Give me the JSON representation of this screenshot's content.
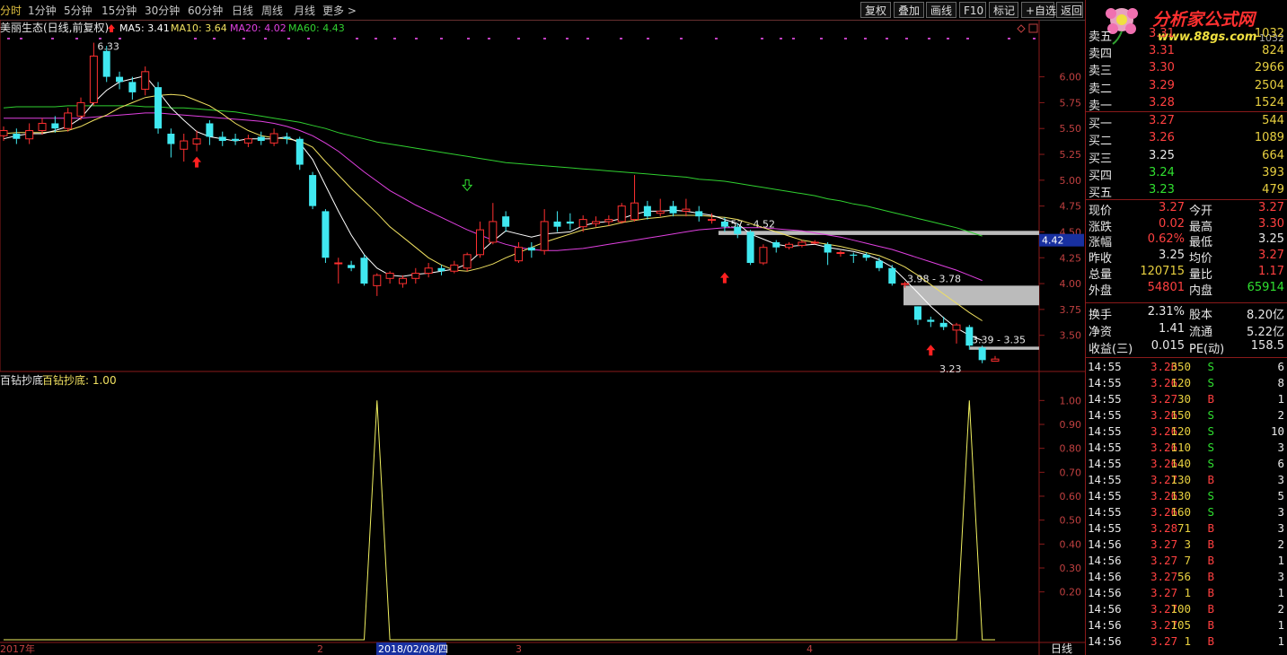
{
  "toolbar": {
    "periods": [
      "分时",
      "1分钟",
      "5分钟",
      "15分钟",
      "30分钟",
      "60分钟",
      "日线",
      "周线",
      "月线",
      "更多 >"
    ],
    "active_index": 0,
    "buttons": [
      "复权",
      "叠加",
      "画线",
      "F10",
      "标记",
      "+自选",
      "返回"
    ]
  },
  "logo": {
    "title": "分析家公式网",
    "url": "www.88gs.com",
    "top_right": "1032"
  },
  "main_chart": {
    "stock_label": "美丽生态(日线,前复权)",
    "ma5": "MA5: 3.41",
    "ma10": "MA10: 3.64",
    "ma20": "MA20: 4.02",
    "ma60": "MA60: 4.43",
    "colors": {
      "ma5": "#ffffff",
      "ma10": "#f0e060",
      "ma20": "#e040e0",
      "ma60": "#30d030",
      "up": "#ff3030",
      "down": "#40e8f0",
      "frame": "#8a1a1a"
    },
    "ytick_labels": [
      "6.00",
      "5.75",
      "5.50",
      "5.25",
      "5.00",
      "4.75",
      "4.50",
      "4.25",
      "4.00",
      "3.75",
      "3.50"
    ],
    "yticks": [
      6.0,
      5.75,
      5.5,
      5.25,
      5.0,
      4.75,
      4.5,
      4.25,
      4.0,
      3.75,
      3.5
    ],
    "ylim": [
      3.15,
      6.5
    ],
    "high_label": "6.33",
    "low_label": "3.23",
    "price_tag": "4.42",
    "price_tag_value": 4.42,
    "zones": [
      {
        "label": "4.57 - 4.52",
        "top": 4.51,
        "bottom": 4.47
      },
      {
        "label": "3.98 - 3.78",
        "top": 3.98,
        "bottom": 3.79
      },
      {
        "label": "3.39 - 3.35",
        "top": 3.39,
        "bottom": 3.36
      }
    ]
  },
  "chart_data": [
    {
      "type": "candlestick",
      "title": "美丽生态(日线,前复权)",
      "ylim": [
        3.15,
        6.5
      ],
      "candles": [
        {
          "o": 5.43,
          "c": 5.48,
          "h": 5.52,
          "l": 5.38
        },
        {
          "o": 5.45,
          "c": 5.4,
          "h": 5.5,
          "l": 5.35
        },
        {
          "o": 5.4,
          "c": 5.48,
          "h": 5.55,
          "l": 5.35
        },
        {
          "o": 5.48,
          "c": 5.55,
          "h": 5.6,
          "l": 5.44
        },
        {
          "o": 5.55,
          "c": 5.5,
          "h": 5.62,
          "l": 5.46
        },
        {
          "o": 5.5,
          "c": 5.65,
          "h": 5.7,
          "l": 5.47
        },
        {
          "o": 5.62,
          "c": 5.75,
          "h": 5.8,
          "l": 5.58
        },
        {
          "o": 5.75,
          "c": 6.2,
          "h": 6.33,
          "l": 5.72
        },
        {
          "o": 6.25,
          "c": 6.0,
          "h": 6.3,
          "l": 5.95
        },
        {
          "o": 6.0,
          "c": 5.95,
          "h": 6.05,
          "l": 5.88
        },
        {
          "o": 5.95,
          "c": 5.85,
          "h": 6.0,
          "l": 5.78
        },
        {
          "o": 5.88,
          "c": 6.05,
          "h": 6.1,
          "l": 5.82
        },
        {
          "o": 5.9,
          "c": 5.5,
          "h": 5.95,
          "l": 5.45
        },
        {
          "o": 5.45,
          "c": 5.35,
          "h": 5.5,
          "l": 5.22
        },
        {
          "o": 5.3,
          "c": 5.38,
          "h": 5.45,
          "l": 5.18
        },
        {
          "o": 5.35,
          "c": 5.4,
          "h": 5.48,
          "l": 5.28
        },
        {
          "o": 5.55,
          "c": 5.42,
          "h": 5.58,
          "l": 5.34
        },
        {
          "o": 5.42,
          "c": 5.38,
          "h": 5.47,
          "l": 5.33
        },
        {
          "o": 5.4,
          "c": 5.38,
          "h": 5.45,
          "l": 5.34
        },
        {
          "o": 5.36,
          "c": 5.4,
          "h": 5.44,
          "l": 5.32
        },
        {
          "o": 5.42,
          "c": 5.38,
          "h": 5.47,
          "l": 5.34
        },
        {
          "o": 5.36,
          "c": 5.45,
          "h": 5.5,
          "l": 5.33
        },
        {
          "o": 5.42,
          "c": 5.4,
          "h": 5.46,
          "l": 5.35
        },
        {
          "o": 5.4,
          "c": 5.15,
          "h": 5.42,
          "l": 5.1
        },
        {
          "o": 5.05,
          "c": 4.75,
          "h": 5.08,
          "l": 4.72
        },
        {
          "o": 4.7,
          "c": 4.25,
          "h": 4.72,
          "l": 4.2
        },
        {
          "o": 4.2,
          "c": 4.2,
          "h": 4.25,
          "l": 4.0
        },
        {
          "o": 4.18,
          "c": 4.15,
          "h": 4.22,
          "l": 4.12
        },
        {
          "o": 4.25,
          "c": 4.0,
          "h": 4.28,
          "l": 3.98
        },
        {
          "o": 3.98,
          "c": 4.08,
          "h": 4.1,
          "l": 3.88
        },
        {
          "o": 4.05,
          "c": 4.1,
          "h": 4.12,
          "l": 4.0
        },
        {
          "o": 4.0,
          "c": 4.05,
          "h": 4.08,
          "l": 3.96
        },
        {
          "o": 4.05,
          "c": 4.1,
          "h": 4.15,
          "l": 4.0
        },
        {
          "o": 4.1,
          "c": 4.15,
          "h": 4.2,
          "l": 4.06
        },
        {
          "o": 4.15,
          "c": 4.12,
          "h": 4.18,
          "l": 4.08
        },
        {
          "o": 4.12,
          "c": 4.18,
          "h": 4.22,
          "l": 4.1
        },
        {
          "o": 4.15,
          "c": 4.28,
          "h": 4.3,
          "l": 4.12
        },
        {
          "o": 4.28,
          "c": 4.52,
          "h": 4.6,
          "l": 4.25
        },
        {
          "o": 4.4,
          "c": 4.6,
          "h": 4.78,
          "l": 4.38
        },
        {
          "o": 4.65,
          "c": 4.55,
          "h": 4.7,
          "l": 4.5
        },
        {
          "o": 4.22,
          "c": 4.35,
          "h": 4.4,
          "l": 4.2
        },
        {
          "o": 4.35,
          "c": 4.32,
          "h": 4.4,
          "l": 4.25
        },
        {
          "o": 4.32,
          "c": 4.6,
          "h": 4.72,
          "l": 4.28
        },
        {
          "o": 4.6,
          "c": 4.55,
          "h": 4.7,
          "l": 4.5
        },
        {
          "o": 4.6,
          "c": 4.58,
          "h": 4.68,
          "l": 4.52
        },
        {
          "o": 4.55,
          "c": 4.62,
          "h": 4.66,
          "l": 4.5
        },
        {
          "o": 4.58,
          "c": 4.6,
          "h": 4.65,
          "l": 4.55
        },
        {
          "o": 4.6,
          "c": 4.62,
          "h": 4.66,
          "l": 4.56
        },
        {
          "o": 4.6,
          "c": 4.75,
          "h": 4.78,
          "l": 4.58
        },
        {
          "o": 4.62,
          "c": 4.78,
          "h": 5.05,
          "l": 4.6
        },
        {
          "o": 4.75,
          "c": 4.65,
          "h": 4.8,
          "l": 4.62
        },
        {
          "o": 4.68,
          "c": 4.7,
          "h": 4.82,
          "l": 4.65
        },
        {
          "o": 4.75,
          "c": 4.68,
          "h": 4.8,
          "l": 4.65
        },
        {
          "o": 4.7,
          "c": 4.72,
          "h": 4.82,
          "l": 4.65
        },
        {
          "o": 4.7,
          "c": 4.65,
          "h": 4.75,
          "l": 4.6
        },
        {
          "o": 4.62,
          "c": 4.62,
          "h": 4.68,
          "l": 4.58
        },
        {
          "o": 4.6,
          "c": 4.55,
          "h": 4.64,
          "l": 4.5
        },
        {
          "o": 4.55,
          "c": 4.48,
          "h": 4.58,
          "l": 4.44
        },
        {
          "o": 4.5,
          "c": 4.2,
          "h": 4.52,
          "l": 4.18
        },
        {
          "o": 4.2,
          "c": 4.35,
          "h": 4.38,
          "l": 4.18
        },
        {
          "o": 4.4,
          "c": 4.35,
          "h": 4.42,
          "l": 4.3
        },
        {
          "o": 4.35,
          "c": 4.38,
          "h": 4.4,
          "l": 4.33
        },
        {
          "o": 4.37,
          "c": 4.4,
          "h": 4.42,
          "l": 4.35
        },
        {
          "o": 4.4,
          "c": 4.4,
          "h": 4.42,
          "l": 4.38
        },
        {
          "o": 4.38,
          "c": 4.3,
          "h": 4.4,
          "l": 4.18
        },
        {
          "o": 4.3,
          "c": 4.3,
          "h": 4.32,
          "l": 4.26
        },
        {
          "o": 4.28,
          "c": 4.27,
          "h": 4.3,
          "l": 4.2
        },
        {
          "o": 4.28,
          "c": 4.25,
          "h": 4.3,
          "l": 4.22
        },
        {
          "o": 4.22,
          "c": 4.15,
          "h": 4.25,
          "l": 4.12
        },
        {
          "o": 4.15,
          "c": 4.0,
          "h": 4.18,
          "l": 3.98
        },
        {
          "o": 4.0,
          "c": 4.0,
          "h": 4.02,
          "l": 3.96
        },
        {
          "o": 3.78,
          "c": 3.65,
          "h": 3.78,
          "l": 3.6
        },
        {
          "o": 3.65,
          "c": 3.63,
          "h": 3.68,
          "l": 3.58
        },
        {
          "o": 3.62,
          "c": 3.58,
          "h": 3.68,
          "l": 3.55
        },
        {
          "o": 3.55,
          "c": 3.6,
          "h": 3.62,
          "l": 3.42
        },
        {
          "o": 3.58,
          "c": 3.4,
          "h": 3.6,
          "l": 3.36
        },
        {
          "o": 3.38,
          "c": 3.26,
          "h": 3.4,
          "l": 3.23
        },
        {
          "o": 3.25,
          "c": 3.27,
          "h": 3.3,
          "l": 3.25
        }
      ],
      "ma5": [
        5.4,
        5.43,
        5.45,
        5.45,
        5.48,
        5.52,
        5.6,
        5.75,
        5.87,
        5.95,
        5.98,
        6.01,
        5.86,
        5.7,
        5.58,
        5.47,
        5.42,
        5.4,
        5.38,
        5.4,
        5.4,
        5.4,
        5.42,
        5.36,
        5.2,
        4.95,
        4.7,
        4.47,
        4.28,
        4.15,
        4.08,
        4.07,
        4.09,
        4.1,
        4.12,
        4.14,
        4.19,
        4.3,
        4.41,
        4.51,
        4.48,
        4.45,
        4.48,
        4.49,
        4.5,
        4.56,
        4.59,
        4.6,
        4.63,
        4.67,
        4.7,
        4.7,
        4.71,
        4.7,
        4.68,
        4.66,
        4.62,
        4.58,
        4.48,
        4.43,
        4.38,
        4.36,
        4.37,
        4.38,
        4.35,
        4.33,
        4.31,
        4.28,
        4.23,
        4.16,
        4.04,
        3.91,
        3.78,
        3.67,
        3.57,
        3.5,
        3.45
      ],
      "ma10": [
        5.45,
        5.46,
        5.46,
        5.46,
        5.47,
        5.48,
        5.52,
        5.58,
        5.63,
        5.7,
        5.75,
        5.8,
        5.82,
        5.83,
        5.82,
        5.77,
        5.72,
        5.64,
        5.55,
        5.48,
        5.43,
        5.41,
        5.4,
        5.38,
        5.32,
        5.18,
        5.05,
        4.92,
        4.8,
        4.68,
        4.55,
        4.45,
        4.35,
        4.25,
        4.18,
        4.13,
        4.12,
        4.15,
        4.19,
        4.25,
        4.3,
        4.35,
        4.4,
        4.44,
        4.48,
        4.52,
        4.54,
        4.56,
        4.59,
        4.61,
        4.63,
        4.64,
        4.66,
        4.66,
        4.66,
        4.65,
        4.64,
        4.62,
        4.58,
        4.54,
        4.5,
        4.46,
        4.42,
        4.4,
        4.38,
        4.36,
        4.33,
        4.3,
        4.27,
        4.22,
        4.16,
        4.08,
        3.99,
        3.9,
        3.81,
        3.72,
        3.64
      ],
      "ma20": [
        5.6,
        5.6,
        5.6,
        5.6,
        5.6,
        5.6,
        5.6,
        5.61,
        5.62,
        5.63,
        5.64,
        5.65,
        5.65,
        5.64,
        5.63,
        5.62,
        5.61,
        5.6,
        5.59,
        5.58,
        5.57,
        5.55,
        5.52,
        5.48,
        5.43,
        5.36,
        5.28,
        5.18,
        5.08,
        4.99,
        4.9,
        4.83,
        4.76,
        4.7,
        4.64,
        4.58,
        4.52,
        4.47,
        4.42,
        4.38,
        4.35,
        4.33,
        4.32,
        4.32,
        4.33,
        4.34,
        4.36,
        4.38,
        4.4,
        4.42,
        4.44,
        4.46,
        4.48,
        4.5,
        4.52,
        4.53,
        4.54,
        4.54,
        4.54,
        4.54,
        4.53,
        4.52,
        4.51,
        4.49,
        4.47,
        4.45,
        4.42,
        4.39,
        4.36,
        4.33,
        4.29,
        4.25,
        4.21,
        4.17,
        4.13,
        4.08,
        4.03
      ],
      "ma60": [
        5.7,
        5.71,
        5.71,
        5.71,
        5.71,
        5.72,
        5.72,
        5.72,
        5.72,
        5.72,
        5.72,
        5.71,
        5.71,
        5.7,
        5.7,
        5.69,
        5.68,
        5.67,
        5.66,
        5.64,
        5.62,
        5.6,
        5.58,
        5.56,
        5.53,
        5.5,
        5.46,
        5.43,
        5.4,
        5.37,
        5.35,
        5.33,
        5.31,
        5.29,
        5.27,
        5.25,
        5.23,
        5.21,
        5.19,
        5.17,
        5.16,
        5.15,
        5.14,
        5.13,
        5.12,
        5.11,
        5.1,
        5.09,
        5.08,
        5.07,
        5.06,
        5.05,
        5.04,
        5.03,
        5.01,
        5.0,
        4.99,
        4.97,
        4.95,
        4.93,
        4.91,
        4.89,
        4.87,
        4.85,
        4.82,
        4.8,
        4.77,
        4.75,
        4.72,
        4.69,
        4.66,
        4.63,
        4.6,
        4.57,
        4.54,
        4.5,
        4.46
      ]
    },
    {
      "type": "line",
      "title": "百钻抄底",
      "ylim": [
        0,
        1.05
      ],
      "yticks": [
        1.0,
        0.9,
        0.8,
        0.7,
        0.6,
        0.5,
        0.4,
        0.3,
        0.2
      ],
      "ytick_labels": [
        "1.00",
        "0.90",
        "0.80",
        "0.70",
        "0.60",
        "0.50",
        "0.40",
        "0.30",
        "0.20"
      ],
      "signal_index": [
        29,
        75
      ],
      "count": 78
    }
  ],
  "indicator": {
    "name": "百钻抄底",
    "label": "百钻抄底: 1.00"
  },
  "xaxis": {
    "labels": [
      "2017年",
      "2",
      "2018/02/08/四",
      "3",
      "4"
    ],
    "period_label": "日线"
  },
  "orderbook": {
    "sell": [
      {
        "label": "卖五",
        "price": "3.31",
        "vol": "1032"
      },
      {
        "label": "卖四",
        "price": "3.31",
        "vol": "824"
      },
      {
        "label": "卖三",
        "price": "3.30",
        "vol": "2966"
      },
      {
        "label": "卖二",
        "price": "3.29",
        "vol": "2504"
      },
      {
        "label": "卖一",
        "price": "3.28",
        "vol": "1524"
      }
    ],
    "buy": [
      {
        "label": "买一",
        "price": "3.27",
        "vol": "544",
        "cls": "red"
      },
      {
        "label": "买二",
        "price": "3.26",
        "vol": "1089",
        "cls": "red"
      },
      {
        "label": "买三",
        "price": "3.25",
        "vol": "664",
        "cls": "white"
      },
      {
        "label": "买四",
        "price": "3.24",
        "vol": "393",
        "cls": "green"
      },
      {
        "label": "买五",
        "price": "3.23",
        "vol": "479",
        "cls": "green"
      }
    ]
  },
  "quote": [
    {
      "l1": "现价",
      "v1": "3.27",
      "c1": "red",
      "l2": "今开",
      "v2": "3.27",
      "c2": "red"
    },
    {
      "l1": "涨跌",
      "v1": "0.02",
      "c1": "red",
      "l2": "最高",
      "v2": "3.30",
      "c2": "red"
    },
    {
      "l1": "涨幅",
      "v1": "0.62%",
      "c1": "red",
      "l2": "最低",
      "v2": "3.25",
      "c2": "white"
    },
    {
      "l1": "昨收",
      "v1": "3.25",
      "c1": "white",
      "l2": "均价",
      "v2": "3.27",
      "c2": "red"
    },
    {
      "l1": "总量",
      "v1": "120715",
      "c1": "yellow",
      "l2": "量比",
      "v2": "1.17",
      "c2": "red"
    },
    {
      "l1": "外盘",
      "v1": "54801",
      "c1": "red",
      "l2": "内盘",
      "v2": "65914",
      "c2": "green"
    }
  ],
  "quote2": [
    {
      "l1": "换手",
      "v1": "2.31%",
      "l2": "股本",
      "v2": "8.20亿"
    },
    {
      "l1": "净资",
      "v1": "1.41",
      "l2": "流通",
      "v2": "5.22亿"
    },
    {
      "l1": "收益(三)",
      "v1": "0.015",
      "l2": "PE(动)",
      "v2": "158.5"
    }
  ],
  "ticks": [
    {
      "t": "14:55",
      "p": "3.26",
      "v": "350",
      "s": "S",
      "n": "6"
    },
    {
      "t": "14:55",
      "p": "3.26",
      "v": "120",
      "s": "S",
      "n": "8"
    },
    {
      "t": "14:55",
      "p": "3.27",
      "v": "30",
      "s": "B",
      "n": "1"
    },
    {
      "t": "14:55",
      "p": "3.26",
      "v": "150",
      "s": "S",
      "n": "2"
    },
    {
      "t": "14:55",
      "p": "3.26",
      "v": "120",
      "s": "S",
      "n": "10"
    },
    {
      "t": "14:55",
      "p": "3.26",
      "v": "110",
      "s": "S",
      "n": "3"
    },
    {
      "t": "14:55",
      "p": "3.26",
      "v": "140",
      "s": "S",
      "n": "6"
    },
    {
      "t": "14:55",
      "p": "3.27",
      "v": "130",
      "s": "B",
      "n": "3"
    },
    {
      "t": "14:55",
      "p": "3.26",
      "v": "130",
      "s": "S",
      "n": "5"
    },
    {
      "t": "14:55",
      "p": "3.26",
      "v": "160",
      "s": "S",
      "n": "3"
    },
    {
      "t": "14:55",
      "p": "3.28",
      "v": "71",
      "s": "B",
      "n": "3"
    },
    {
      "t": "14:56",
      "p": "3.27",
      "v": "3",
      "s": "B",
      "n": "2"
    },
    {
      "t": "14:56",
      "p": "3.27",
      "v": "7",
      "s": "B",
      "n": "1"
    },
    {
      "t": "14:56",
      "p": "3.27",
      "v": "56",
      "s": "B",
      "n": "3"
    },
    {
      "t": "14:56",
      "p": "3.27",
      "v": "1",
      "s": "B",
      "n": "1"
    },
    {
      "t": "14:56",
      "p": "3.27",
      "v": "100",
      "s": "B",
      "n": "2"
    },
    {
      "t": "14:56",
      "p": "3.27",
      "v": "105",
      "s": "B",
      "n": "1"
    },
    {
      "t": "14:56",
      "p": "3.27",
      "v": "1",
      "s": "B",
      "n": "1"
    }
  ]
}
